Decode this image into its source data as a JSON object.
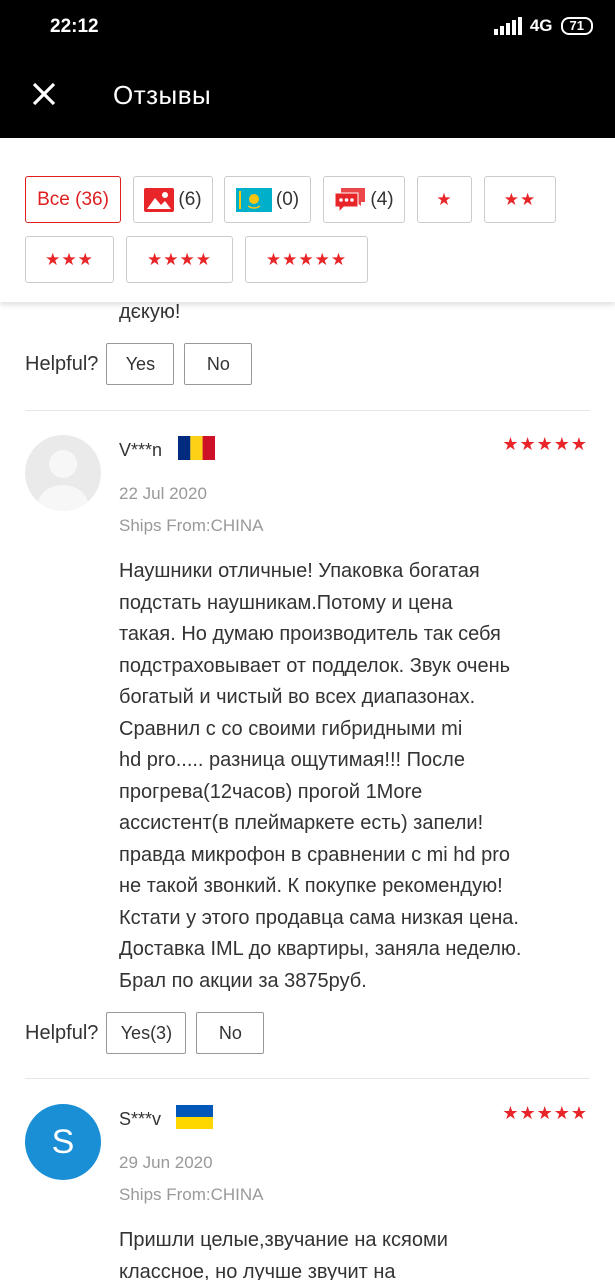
{
  "status": {
    "time": "22:12",
    "network": "4G",
    "network_sub": "ıl",
    "battery": "71"
  },
  "header": {
    "title": "Отзывы"
  },
  "filters": {
    "all": "Все (36)",
    "photos": "(6)",
    "local": "(0)",
    "comments": "(4)",
    "star1": "★",
    "star2": "★★",
    "star3": "★★★",
    "star4": "★★★★",
    "star5": "★★★★★"
  },
  "prev_review": {
    "text_fragment": "дєкую!",
    "helpful_label": "Helpful?",
    "yes_label": "Yes",
    "no_label": "No"
  },
  "reviews": [
    {
      "name": "V***n",
      "flag": "RO",
      "stars": "★★★★★",
      "date": "22 Jul 2020",
      "ships_from": "Ships From:CHINA",
      "text_lines": [
        "Наушники отличные! Упаковка богатая",
        "подстать наушникам.Потому и цена",
        "такая. Но думаю производитель так себя",
        "подстраховывает от подделок. Звук очень",
        "богатый и чистый во всех диапазонах.",
        "Сравнил с со своими гибридными mi",
        "hd pro..... разница ощутимая!!! После",
        "прогрева(12часов) прогой 1More",
        "ассистент(в плеймаркете есть) запели!",
        "правда микрофон в сравнении с mi hd pro",
        "не такой звонкий. К покупке рекомендую!",
        "Кстати у этого продавца сама низкая цена.",
        "Доставка IML до квартиры, заняла неделю.",
        "Брал по акции за 3875руб."
      ],
      "helpful_label": "Helpful?",
      "yes_label": "Yes(3)",
      "no_label": "No"
    },
    {
      "avatar_letter": "S",
      "name": "S***v",
      "flag": "UA",
      "stars": "★★★★★",
      "date": "29 Jun 2020",
      "ships_from": "Ships From:CHINA",
      "text_lines": [
        "Пришли целые,звучание на ксяоми",
        "классное, но лучше звучит на"
      ]
    }
  ],
  "colors": {
    "accent": "#e8262a",
    "header_bg": "#000000",
    "avatar_blue": "#1a8fd6"
  }
}
